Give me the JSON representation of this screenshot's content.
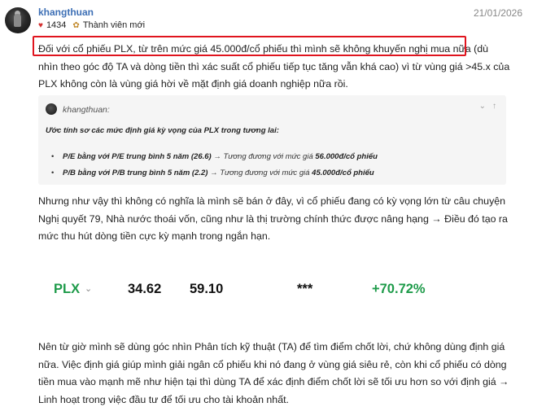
{
  "post": {
    "username": "khangthuan",
    "likes": "1434",
    "rank": "Thành viên mới",
    "date": "21/01/2026"
  },
  "body": {
    "p1_highlight": "Đối với cổ phiếu PLX, từ trên mức giá 45.000đ/cổ phiếu thì mình sẽ không khuyến nghị mua nữa",
    "p1_rest": " (dù nhìn theo góc độ TA và dòng tiền thì xác suất cổ phiếu tiếp tục tăng vẫn khá cao) vì từ vùng giá >45.x của PLX không còn là vùng giá hời về mặt định giá doanh nghiệp nữa rồi.",
    "p2": "Nhưng như vậy thì không có nghĩa là mình sẽ bán ở đây, vì cổ phiếu đang có kỳ vọng lớn từ câu chuyện Nghị quyết 79, Nhà nước thoái vốn, cũng như là thị trường chính thức được nâng hạng → Điều đó tạo ra mức thu hút dòng tiền cực kỳ mạnh trong ngắn hạn.",
    "p3": "Nên từ giờ mình sẽ dùng góc nhìn Phân tích kỹ thuật (TA) để tìm điểm chốt lời, chứ không dùng định giá nữa. Việc định giá giúp mình giải ngân cổ phiếu khi nó đang ở vùng giá siêu rẻ, còn khi cổ phiếu có dòng tiền mua vào mạnh mẽ như hiện tại thì dùng TA để xác định điểm chốt lời sẽ tối ưu hơn so với định giá → Linh hoạt trong việc đầu tư để tối ưu cho tài khoản nhất."
  },
  "quote": {
    "user": "khangthuan:",
    "title": "Ước tính sơ các mức định giá kỳ vọng của PLX trong tương lai:",
    "items": [
      {
        "label": "P/E bằng với P/E trung bình 5 năm (26.6)",
        "text": " → Tương đương với mức giá ",
        "value": "56.000đ/cổ phiếu"
      },
      {
        "label": "P/B bằng với P/B trung bình 5 năm (2.2)",
        "text": " → Tương đương với mức giá ",
        "value": "45.000đ/cổ phiếu"
      }
    ]
  },
  "ticker": {
    "symbol": "PLX",
    "val1": "34.62",
    "val2": "59.10",
    "val3": "***",
    "change": "+70.72%"
  },
  "colors": {
    "accent": "#3d6fb5",
    "positive": "#1e9b4a",
    "highlight_border": "#e0141e"
  }
}
